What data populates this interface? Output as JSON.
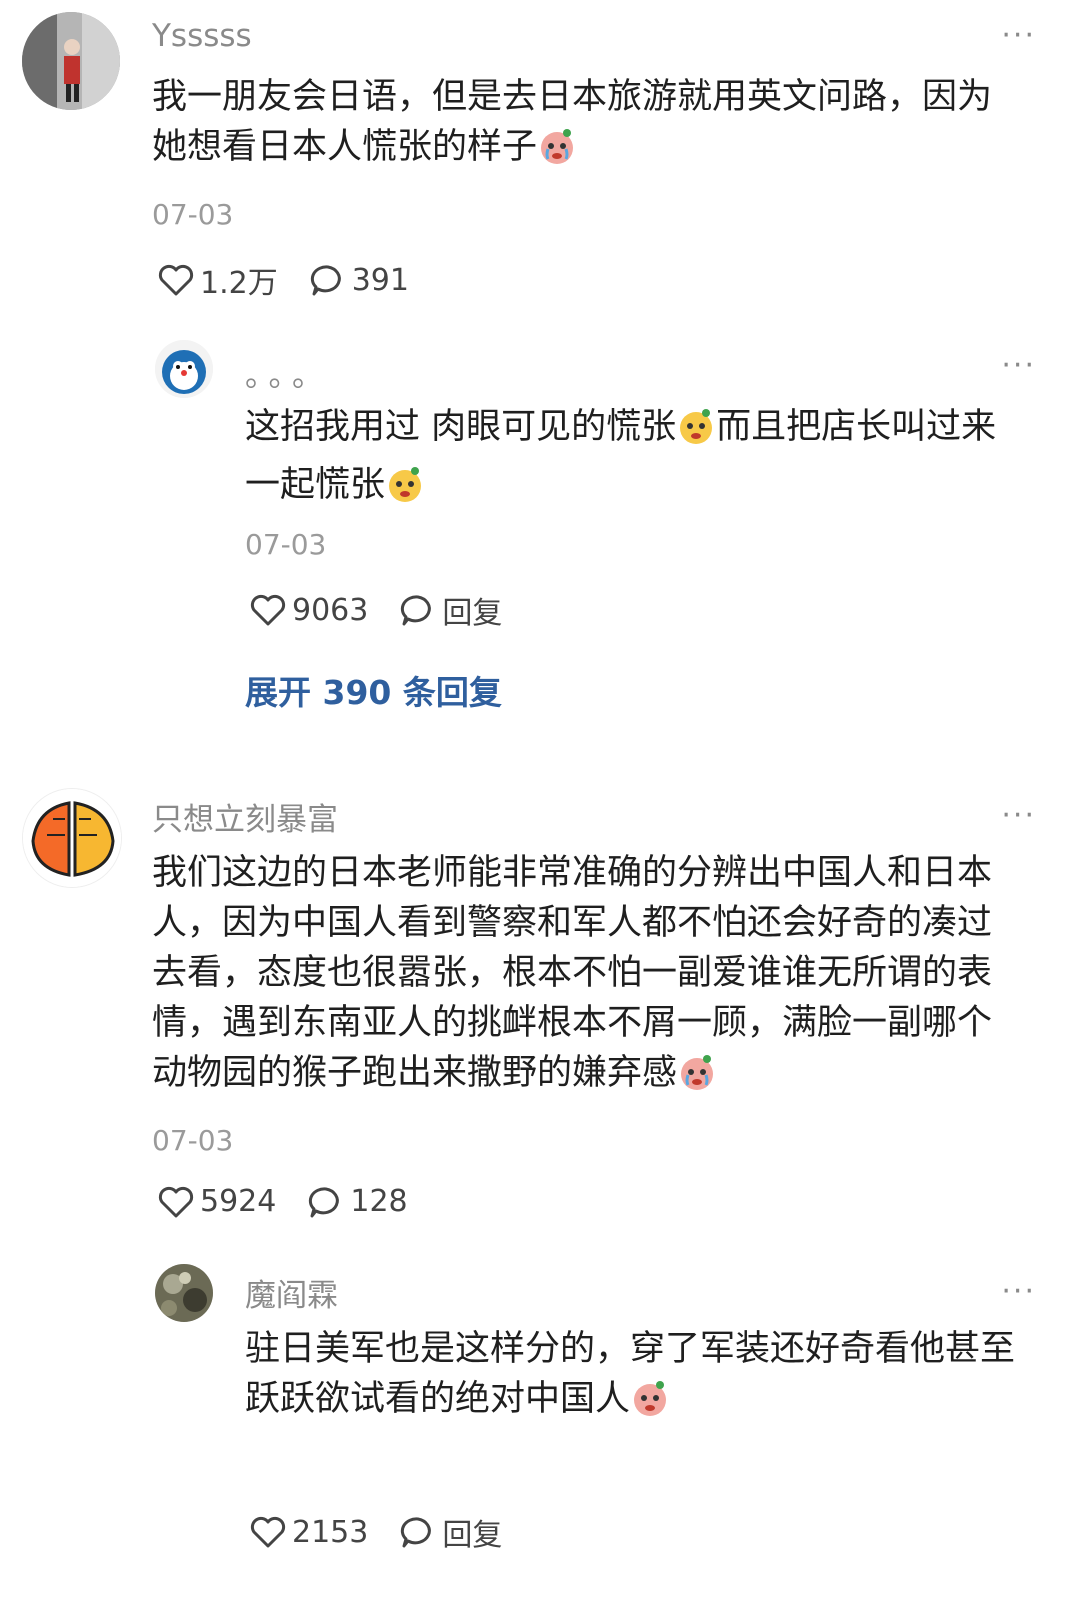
{
  "comments": [
    {
      "name": "Ysssss",
      "text": "我一朋友会日语，但是去日本旅游就用英文问路，因为她想看日本人慌张的样子",
      "date": "07-03",
      "likes": "1.2万",
      "replies_count": "391",
      "reply": {
        "name": "。。。",
        "text_part1": "这招我用过 肉眼可见的慌张",
        "text_part2": "而且把店长叫过来一起慌张",
        "date": "07-03",
        "likes": "9063",
        "reply_label": "回复"
      },
      "expand_label": "展开 390 条回复"
    },
    {
      "name": "只想立刻暴富",
      "text": "我们这边的日本老师能非常准确的分辨出中国人和日本人，因为中国人看到警察和军人都不怕还会好奇的凑过去看，态度也很嚣张，根本不怕一副爱谁谁无所谓的表情，遇到东南亚人的挑衅根本不屑一顾，满脸一副哪个动物园的猴子跑出来撒野的嫌弃感",
      "date": "07-03",
      "likes": "5924",
      "replies_count": "128",
      "reply": {
        "name": "魔阎霖",
        "text": "驻日美军也是这样分的，穿了军装还好奇看他甚至跃跃欲试看的绝对中国人",
        "likes": "2153",
        "reply_label": "回复"
      }
    }
  ],
  "icons": {
    "more": "more-dots-icon",
    "like": "heart-icon",
    "comment": "comment-bubble-icon",
    "emoji": "crying-face-emoji"
  }
}
